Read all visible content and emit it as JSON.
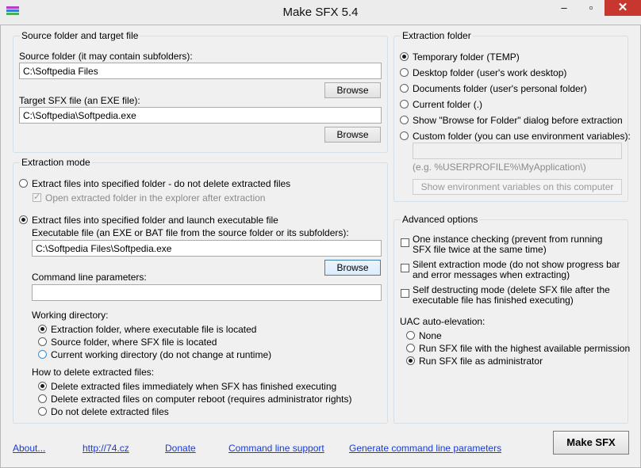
{
  "window": {
    "title": "Make SFX 5.4",
    "minimize": "–",
    "maximize": "▫",
    "close": "✕"
  },
  "source_group": {
    "legend": "Source folder and target file",
    "source_label": "Source folder (it may contain subfolders):",
    "source_value": "C:\\Softpedia Files",
    "browse1": "Browse",
    "target_label": "Target SFX file (an EXE file):",
    "target_value": "C:\\Softpedia\\Softpedia.exe",
    "browse2": "Browse"
  },
  "mode_group": {
    "legend": "Extraction mode",
    "option1": "Extract files into specified folder - do not delete extracted files",
    "option1_check": "Open extracted folder in the explorer after extraction",
    "option2": "Extract files into specified folder and launch executable file",
    "exe_label": "Executable file (an EXE or BAT file from the source folder or its subfolders):",
    "exe_value": "C:\\Softpedia Files\\Softpedia.exe",
    "browse3": "Browse",
    "cmd_label": "Command line parameters:",
    "cmd_value": "",
    "workdir_label": "Working directory:",
    "workdir_options": [
      "Extraction folder, where executable file is located",
      "Source folder, where SFX file is located",
      "Current working directory (do not change at runtime)"
    ],
    "delete_label": "How to delete extracted files:",
    "delete_options": [
      "Delete extracted files immediately when SFX has finished executing",
      "Delete extracted files on computer reboot (requires administrator rights)",
      "Do not delete extracted files"
    ]
  },
  "extraction_folder": {
    "legend": "Extraction folder",
    "options": [
      "Temporary folder (TEMP)",
      "Desktop folder (user's work desktop)",
      "Documents folder (user's personal folder)",
      "Current folder (.)",
      "Show \"Browse for Folder\" dialog before extraction",
      "Custom folder (you can use environment variables):"
    ],
    "custom_value": "",
    "hint": "(e.g. %USERPROFILE%\\MyApplication\\)",
    "env_button": "Show environment variables on this computer"
  },
  "advanced": {
    "legend": "Advanced options",
    "options": [
      "One instance checking (prevent from running SFX file twice at the same time)",
      "Silent extraction mode (do not show progress bar and error messages when extracting)",
      "Self destructing mode (delete SFX file after the executable file has finished executing)"
    ],
    "uac_label": "UAC auto-elevation:",
    "uac_options": [
      "None",
      "Run SFX file with the highest available permission",
      "Run SFX file as administrator"
    ]
  },
  "footer": {
    "about": "About...",
    "site": "http://74.cz",
    "donate": "Donate",
    "cmd_support": "Command line support",
    "generate": "Generate command line parameters",
    "make": "Make SFX"
  }
}
